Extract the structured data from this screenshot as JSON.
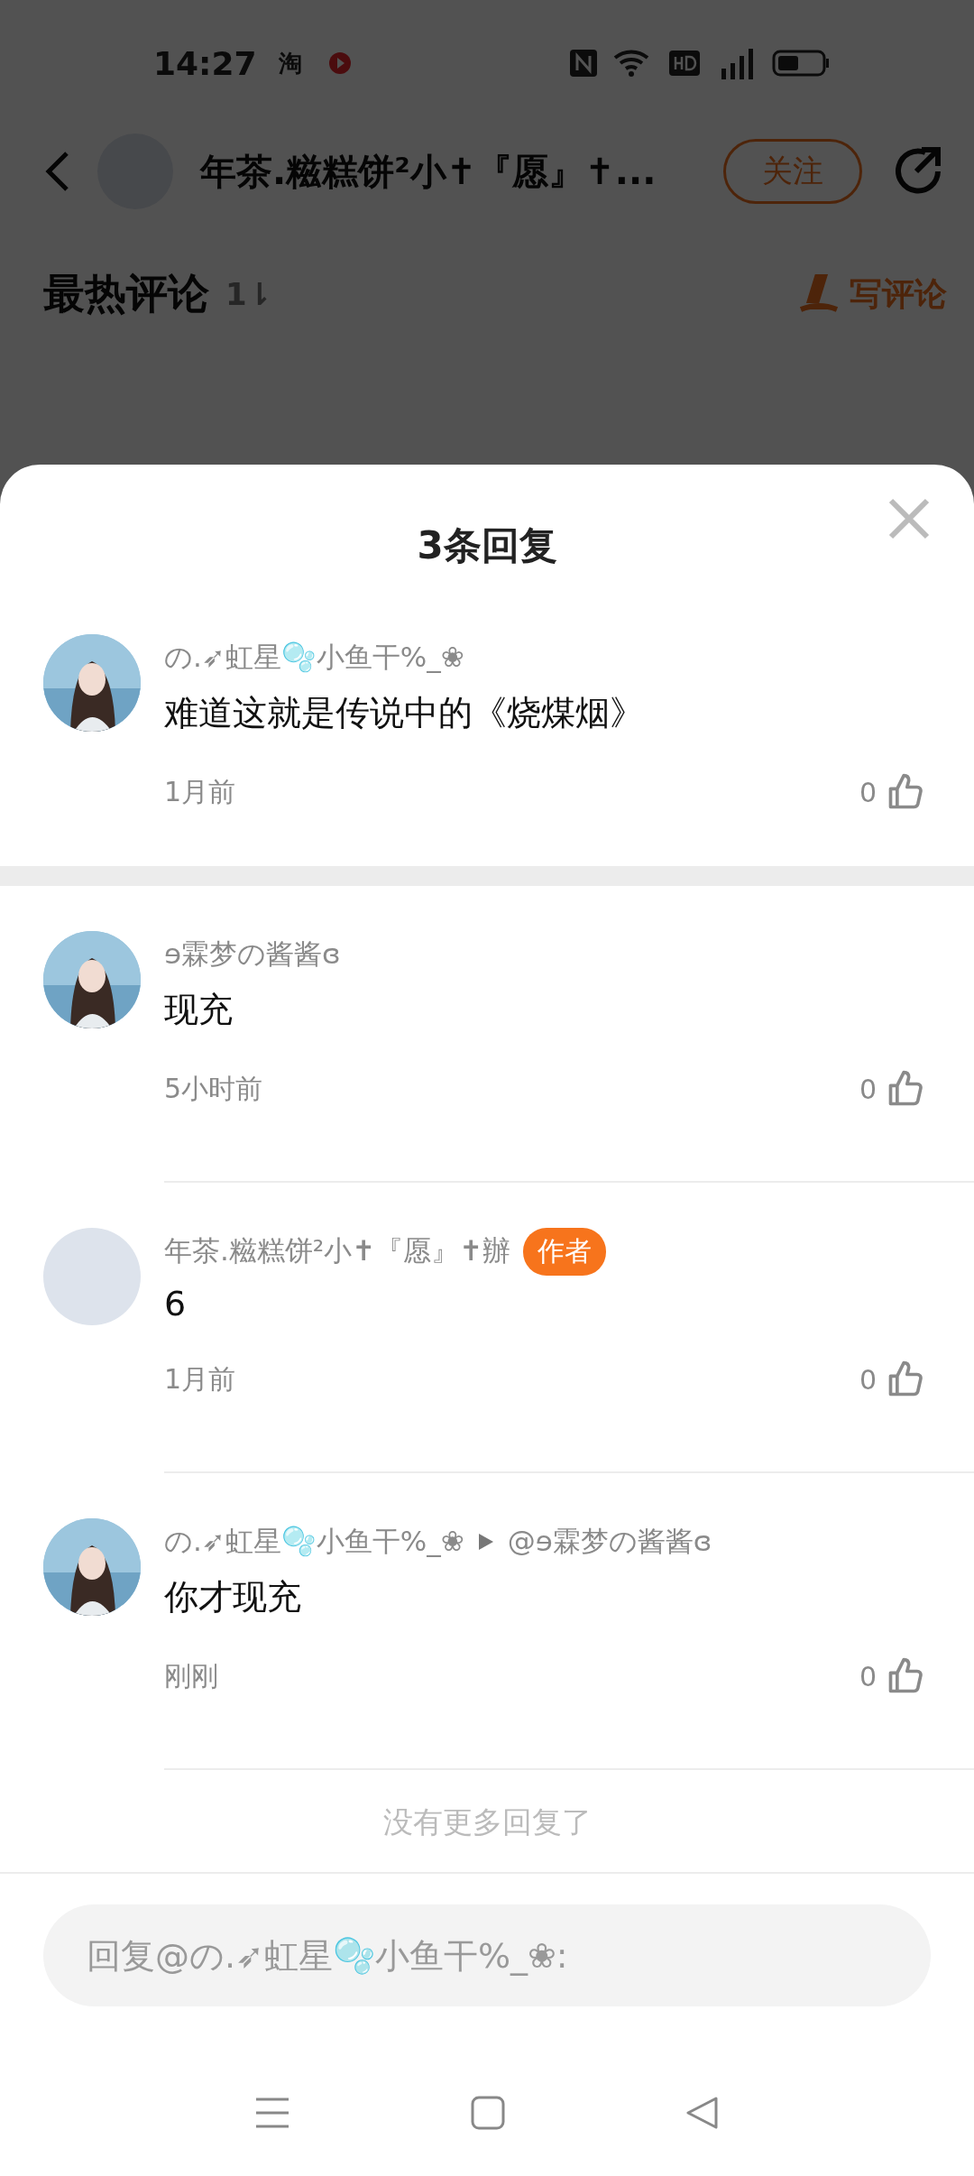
{
  "status_bar": {
    "time": "14:27",
    "app_label": "淘"
  },
  "header": {
    "title": "年茶.糍糕饼²小✝『愿』✝...",
    "follow": "关注"
  },
  "section": {
    "title": "最热评论",
    "sort": "1⇂",
    "write": "写评论"
  },
  "sheet": {
    "title": "3条回复",
    "comments": [
      {
        "name": "の.➶虹星🫧小鱼干%_❀",
        "text": "难道这就是传说中的《烧煤烟》",
        "time": "1月前",
        "likes": "0"
      },
      {
        "name": "ɘ霖梦の酱酱ɞ",
        "text": "现充",
        "time": "5小时前",
        "likes": "0"
      },
      {
        "avatar": {
          "kind": "blank"
        },
        "name": "年茶.糍糕饼²小✝『愿』✝辦",
        "badge": "作者",
        "text": "6",
        "time": "1月前",
        "likes": "0"
      },
      {
        "name": "の.➶虹星🫧小鱼干%_❀",
        "reply_to": "@ɘ霖梦の酱酱ɞ",
        "text": "你才现充",
        "time": "刚刚",
        "likes": "0"
      }
    ],
    "end_note": "没有更多回复了",
    "reply_field": {
      "placeholder": "回复@の.➶虹星🫧小鱼干%_❀:"
    }
  }
}
